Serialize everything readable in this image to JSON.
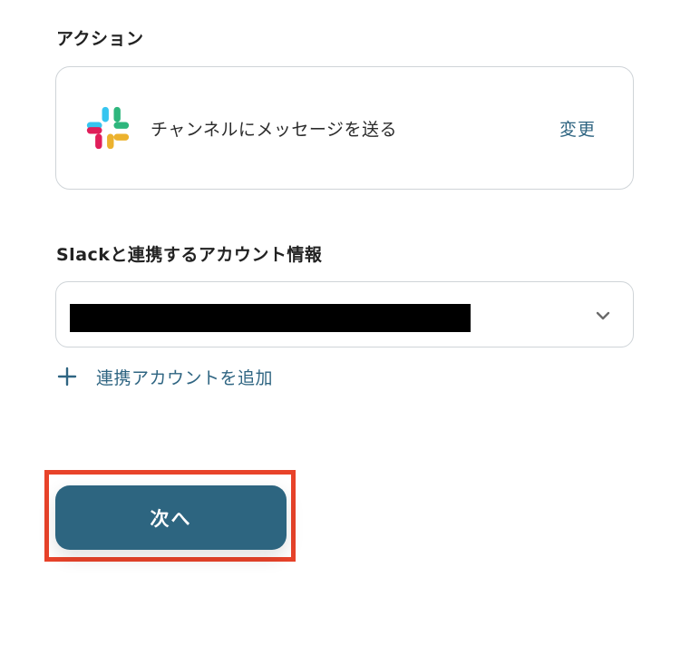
{
  "action_section": {
    "label": "アクション",
    "app_icon": "slack-icon",
    "action_name": "チャンネルにメッセージを送る",
    "change_label": "変更"
  },
  "account_section": {
    "label": "Slackと連携するアカウント情報",
    "selected_value_redacted": true,
    "dropdown_icon": "chevron-down-icon",
    "add_account_icon": "plus-icon",
    "add_account_label": "連携アカウントを追加"
  },
  "footer": {
    "next_label": "次へ"
  },
  "colors": {
    "accent": "#2f6582",
    "button_bg": "#2d6580",
    "highlight": "#e8432a",
    "border": "#cfd4d8",
    "slack_blue": "#36C5F0",
    "slack_green": "#2EB67D",
    "slack_yellow": "#ECB22E",
    "slack_red": "#E01E5A"
  }
}
